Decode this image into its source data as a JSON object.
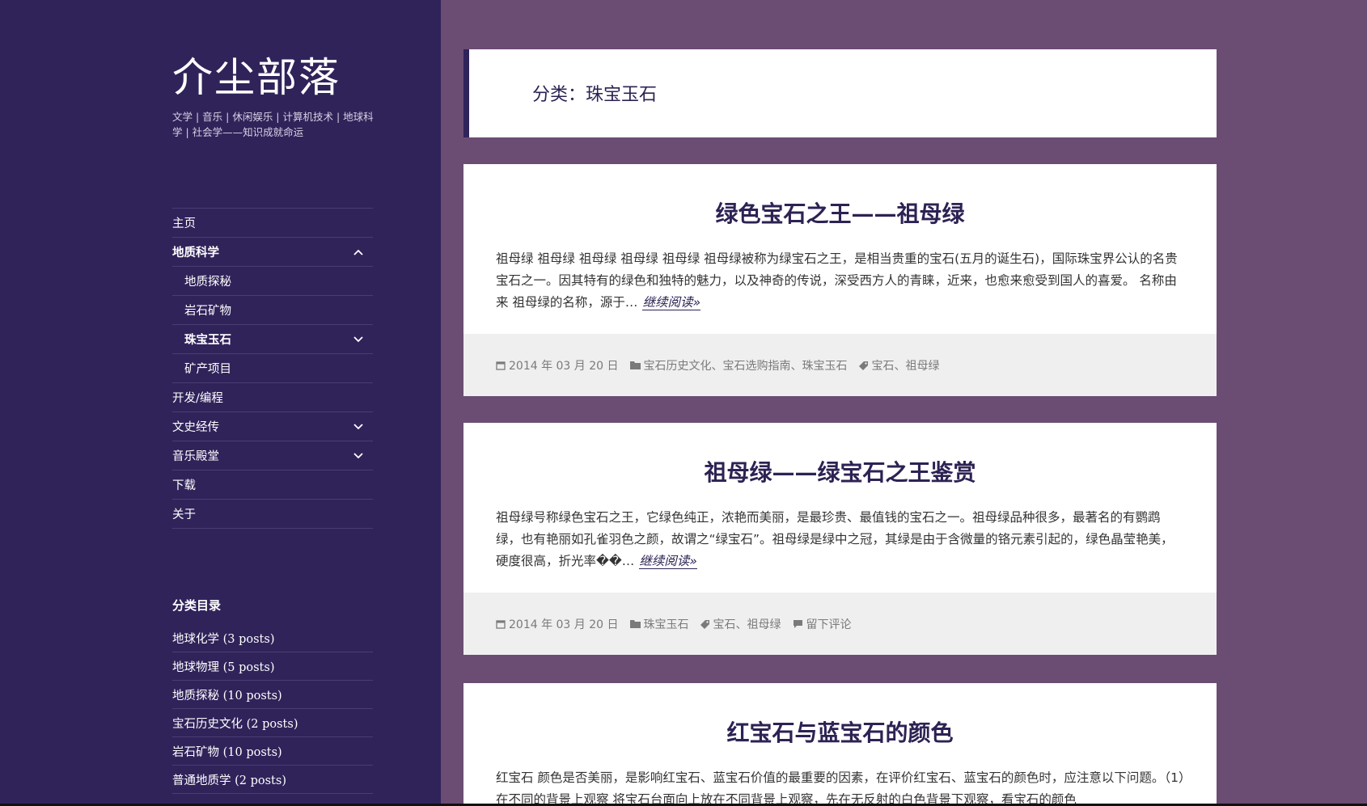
{
  "site": {
    "title": "介尘部落",
    "description": "文学 | 音乐 | 休闲娱乐 | 计算机技术 | 地球科学 | 社会学——知识成就命运"
  },
  "nav": {
    "items": [
      {
        "label": "主页"
      },
      {
        "label": "地质科学"
      },
      {
        "label": "地质探秘"
      },
      {
        "label": "岩石矿物"
      },
      {
        "label": "珠宝玉石"
      },
      {
        "label": "矿产项目"
      },
      {
        "label": "开发/编程"
      },
      {
        "label": "文史经传"
      },
      {
        "label": "音乐殿堂"
      },
      {
        "label": "下载"
      },
      {
        "label": "关于"
      }
    ]
  },
  "categories_widget": {
    "title": "分类目录",
    "items": [
      {
        "label": "地球化学 (3 posts)"
      },
      {
        "label": "地球物理 (5 posts)"
      },
      {
        "label": "地质探秘 (10 posts)"
      },
      {
        "label": "宝石历史文化 (2 posts)"
      },
      {
        "label": "岩石矿物 (10 posts)"
      },
      {
        "label": "普通地质学 (2 posts)"
      }
    ]
  },
  "page": {
    "header": "分类：珠宝玉石"
  },
  "articles": [
    {
      "title": "绿色宝石之王——祖母绿",
      "excerpt": "祖母绿 祖母绿 祖母绿 祖母绿 祖母绿 祖母绿被称为绿宝石之王，是相当贵重的宝石(五月的诞生石)，国际珠宝界公认的名贵宝石之一。因其特有的绿色和独特的魅力，以及神奇的传说，深受西方人的青睐，近来，也愈来愈受到国人的喜爱。 名称由来 祖母绿的名称，源于…",
      "more": "继续阅读»",
      "date": "2014 年 03 月 20 日",
      "categories": "宝石历史文化、宝石选购指南、珠宝玉石",
      "tags": "宝石、祖母绿"
    },
    {
      "title": "祖母绿——绿宝石之王鉴赏",
      "excerpt": "祖母绿号称绿色宝石之王，它绿色纯正，浓艳而美丽，是最珍贵、最值钱的宝石之一。祖母绿品种很多，最著名的有鹦鹉绿，也有艳丽如孔雀羽色之颜，故谓之“绿宝石”。祖母绿是绿中之冠，其绿是由于含微量的铬元素引起的，绿色晶莹艳美，硬度很高，折光率��…",
      "more": "继续阅读»",
      "date": "2014 年 03 月 20 日",
      "categories": "珠宝玉石",
      "tags": "宝石、祖母绿",
      "comments": "留下评论"
    },
    {
      "title": "红宝石与蓝宝石的颜色",
      "excerpt": "红宝石 颜色是否美丽，是影响红宝石、蓝宝石价值的最重要的因素，在评价红宝石、蓝宝石的颜色时，应注意以下问题。（1）在不同的背景上观察 将宝石台面向上放在不同背景上观察，先在无反射的白色背景下观察，看宝石的颜色"
    }
  ],
  "colors": {
    "sidebar_bg": "#30235a",
    "page_bg": "#6b4c73",
    "title_color": "#2d2253",
    "footer_bg": "#efefef"
  }
}
